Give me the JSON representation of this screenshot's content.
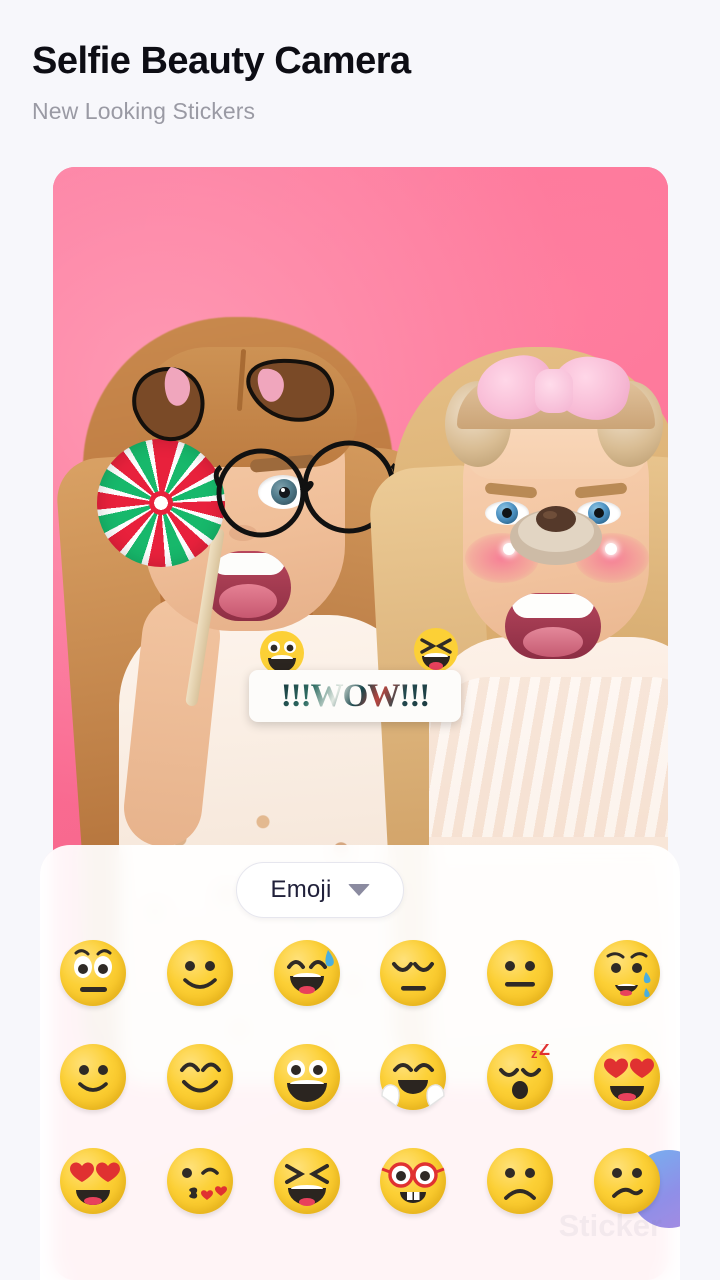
{
  "header": {
    "title": "Selfie Beauty Camera",
    "subtitle": "New Looking Stickers"
  },
  "photo": {
    "background_color": "#f76a8c",
    "applied_stickers": [
      {
        "name": "dog-ears-sticker",
        "position": "top-left"
      },
      {
        "name": "round-glasses-sticker",
        "position": "left-face"
      },
      {
        "name": "lollipop-prop",
        "colors": [
          "#e8213c",
          "#17b86b",
          "#ffffff"
        ]
      },
      {
        "name": "pink-bow-headband-sticker",
        "position": "top-right"
      },
      {
        "name": "dog-nose-sticker",
        "position": "right-face"
      },
      {
        "name": "blush-cheeks-sticker",
        "position": "right-face"
      }
    ],
    "text_sticker": {
      "label": "!!!WOW!!!",
      "left_emoji": "grinning-open-eyes-emoji",
      "right_emoji": "squinting-laugh-emoji",
      "card_color": "#fdfcfa"
    }
  },
  "sticker_panel": {
    "category": {
      "label": "Emoji",
      "chevron_icon": "chevron-down-icon"
    },
    "watermark": "Sticker",
    "accent_circle_color": "#8f8fe8",
    "emoji_rows": [
      [
        {
          "name": "worried-face-emoji"
        },
        {
          "name": "slightly-smiling-face-emoji"
        },
        {
          "name": "grinning-sweat-face-emoji"
        },
        {
          "name": "pensive-face-emoji"
        },
        {
          "name": "neutral-face-emoji"
        },
        {
          "name": "crying-face-emoji"
        }
      ],
      [
        {
          "name": "smiling-face-emoji"
        },
        {
          "name": "blush-smiling-face-emoji"
        },
        {
          "name": "grinning-face-emoji"
        },
        {
          "name": "hugging-face-emoji"
        },
        {
          "name": "sleeping-face-emoji",
          "badge": "zZ"
        },
        {
          "name": "heart-eyes-face-emoji"
        }
      ],
      [
        {
          "name": "heart-eyes-face-emoji"
        },
        {
          "name": "kiss-blowing-heart-emoji"
        },
        {
          "name": "squinting-laugh-face-emoji"
        },
        {
          "name": "nerd-face-emoji"
        },
        {
          "name": "frowning-face-emoji"
        },
        {
          "name": "confused-face-emoji"
        }
      ]
    ]
  },
  "colors": {
    "page_background": "#f7f7fb",
    "emoji_yellow": "#fcd036",
    "title_text": "#0d0d14",
    "subtitle_text": "#9a9aa4"
  }
}
